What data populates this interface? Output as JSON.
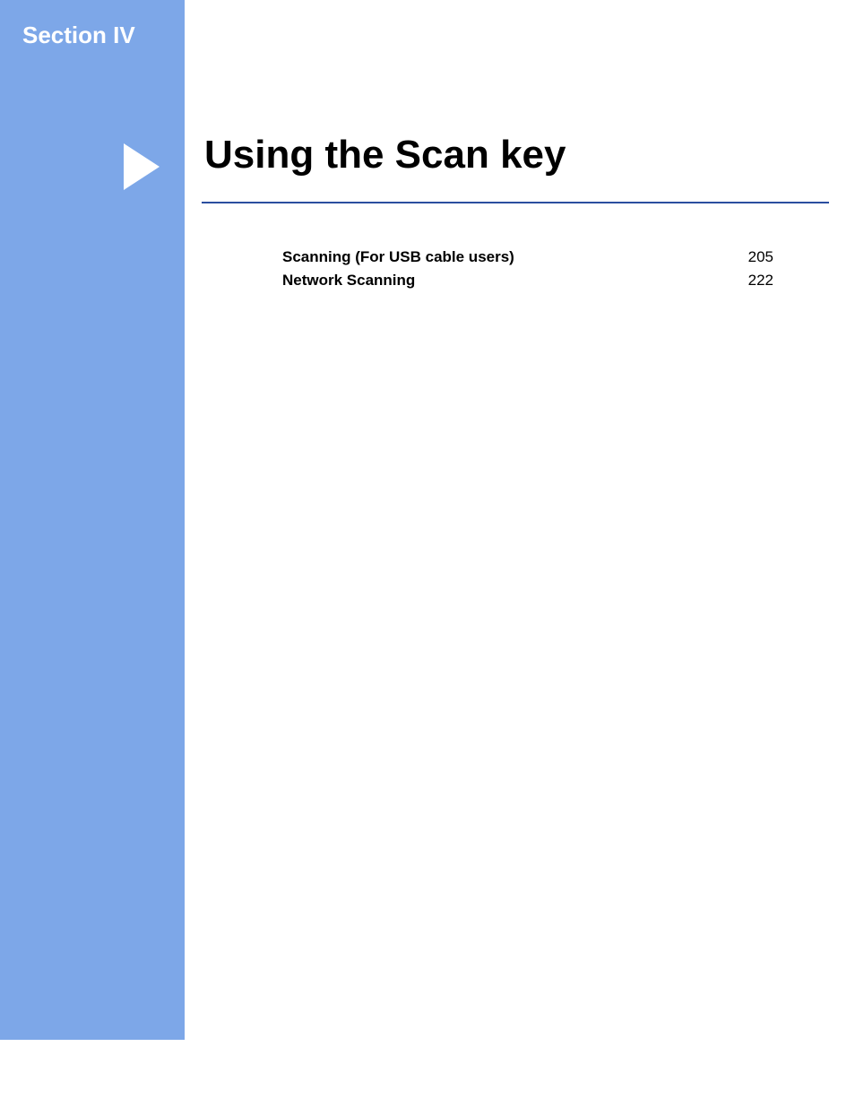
{
  "section_label": "Section IV",
  "title": "Using the Scan key",
  "toc": [
    {
      "title": "Scanning (For USB cable users)",
      "page": "205"
    },
    {
      "title": "Network Scanning",
      "page": "222"
    }
  ]
}
